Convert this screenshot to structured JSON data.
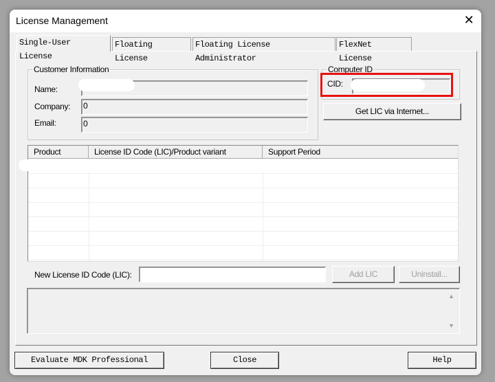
{
  "window": {
    "title": "License Management",
    "close_icon": "close-icon"
  },
  "tabs": [
    {
      "label": "Single-User License",
      "selected": true
    },
    {
      "label": "Floating License",
      "selected": false
    },
    {
      "label": "Floating License Administrator",
      "selected": false
    },
    {
      "label": "FlexNet License",
      "selected": false
    }
  ],
  "customer": {
    "group_label": "Customer Information",
    "name_label": "Name:",
    "name_value": "",
    "company_label": "Company:",
    "company_value": "0",
    "email_label": "Email:",
    "email_value": "0"
  },
  "computer": {
    "group_label": "Computer ID",
    "cid_label": "CID:",
    "cid_value": "",
    "highlight_color": "#e81010"
  },
  "get_lic_button": "Get LIC via Internet...",
  "table": {
    "columns": [
      "Product",
      "License ID Code (LIC)/Product variant",
      "Support Period"
    ],
    "rows": []
  },
  "new_lic": {
    "label": "New License ID Code (LIC):",
    "value": "",
    "add_button": "Add LIC",
    "uninstall_button": "Uninstall..."
  },
  "scrollbar": {
    "up_icon": "arrow-up-icon",
    "down_icon": "arrow-down-icon"
  },
  "footer": {
    "evaluate_button": "Evaluate MDK Professional",
    "close_button": "Close",
    "help_button": "Help"
  }
}
